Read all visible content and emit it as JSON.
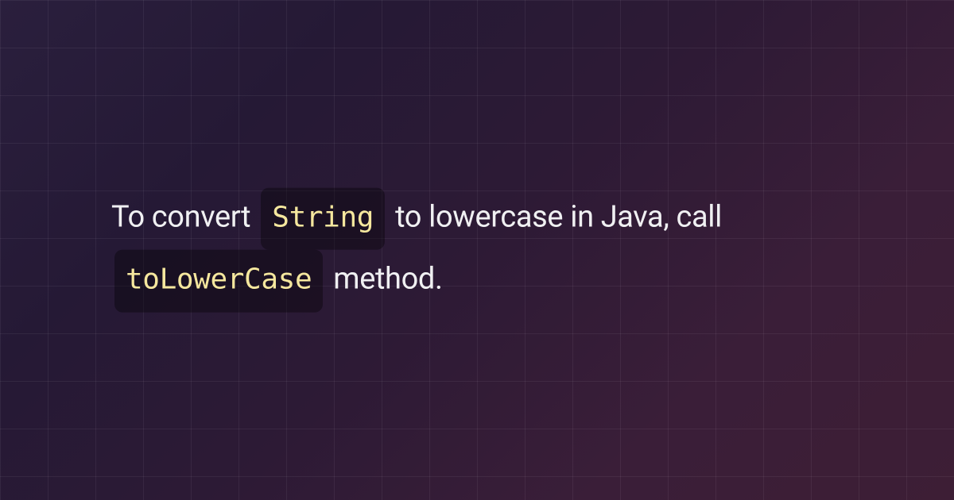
{
  "content": {
    "segment1": "To convert ",
    "code1": "String",
    "segment2": " to lowercase in Java, call ",
    "code2": "toLowerCase",
    "segment3": " method."
  }
}
